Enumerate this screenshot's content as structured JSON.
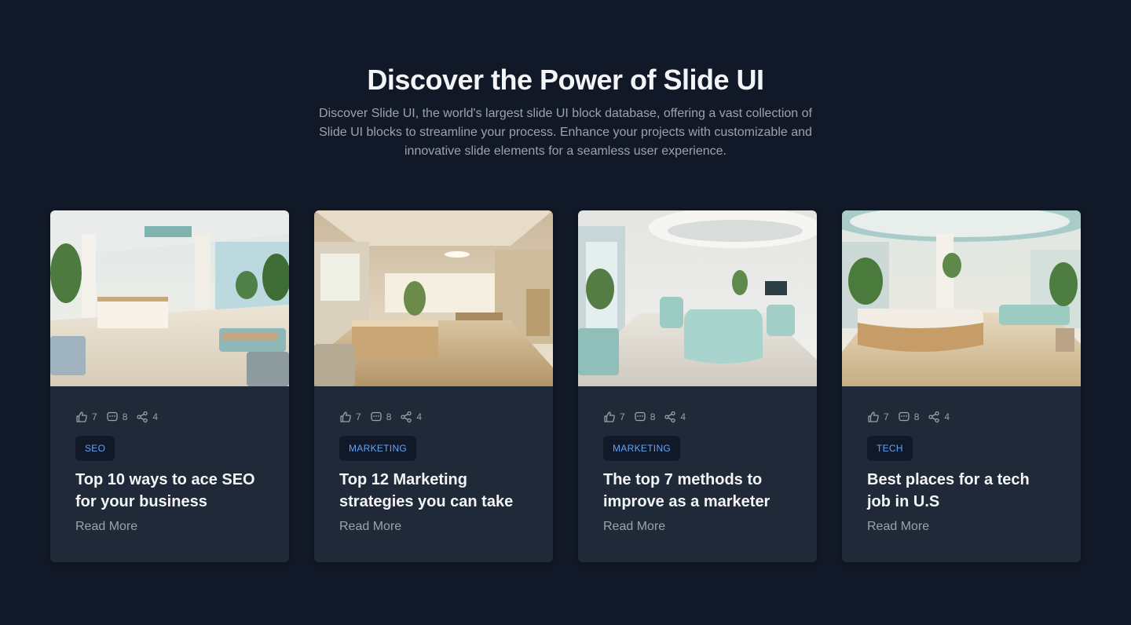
{
  "hero": {
    "title": "Discover the Power of Slide UI",
    "description": "Discover Slide UI, the world's largest slide UI block database, offering a vast collection of Slide UI blocks to streamline your process. Enhance your projects with customizable and innovative slide elements for a seamless user experience."
  },
  "colors": {
    "background": "#111827",
    "card": "#1f2937",
    "tag_text": "#60a5fa",
    "muted": "#9ca3af"
  },
  "icons": {
    "likes": "thumbs-up-icon",
    "comments": "comment-icon",
    "shares": "share-icon"
  },
  "cards": [
    {
      "likes": "7",
      "comments": "8",
      "shares": "4",
      "tag": "SEO",
      "title": "Top 10 ways to ace SEO for your business",
      "link": "Read More"
    },
    {
      "likes": "7",
      "comments": "8",
      "shares": "4",
      "tag": "MARKETING",
      "title": "Top 12 Marketing strategies you can take",
      "link": "Read More"
    },
    {
      "likes": "7",
      "comments": "8",
      "shares": "4",
      "tag": "MARKETING",
      "title": "The top 7 methods to improve as a marketer",
      "link": "Read More"
    },
    {
      "likes": "7",
      "comments": "8",
      "shares": "4",
      "tag": "TECH",
      "title": "Best places for a tech job in U.S",
      "link": "Read More"
    }
  ]
}
